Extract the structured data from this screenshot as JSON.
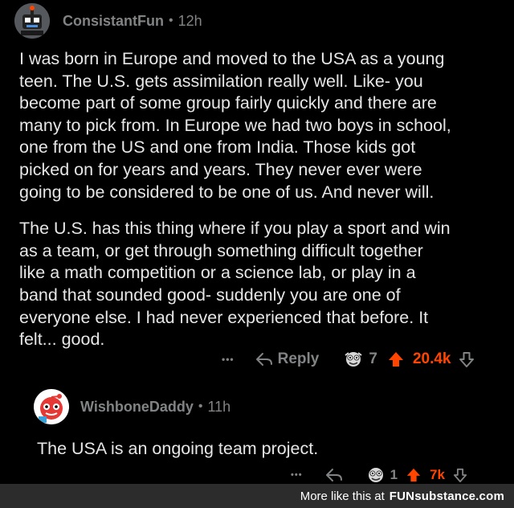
{
  "comment1": {
    "username": "ConsistantFun",
    "separator": "•",
    "time": "12h",
    "paragraph1_lines": [
      "I was born in Europe and moved to the USA as a young",
      "teen. The U.S. gets assimilation really well. Like- you",
      "become part of some group fairly quickly and there are",
      "many to pick from. In Europe we had two boys in school,",
      "one from the US and one from India. Those kids got",
      "picked on for years and years. They never ever were",
      "going to be considered to be one of us. And never will."
    ],
    "paragraph2_lines": [
      "The U.S. has this thing where if you play a sport and win",
      "as a team, or get through something difficult together",
      "like a math competition or a science lab, or play in a",
      "band that sounded good- suddenly you are one of",
      "everyone else. I had never experienced that before. It",
      "felt... good."
    ],
    "actions": {
      "more": "•••",
      "reply_icon": "reply-arrow-icon",
      "reply_label": "Reply",
      "award_icon": "award-face-icon",
      "award_count": "7",
      "upvote_icon": "upvote-arrow-icon",
      "upvote_count": "20.4k",
      "downvote_icon": "downvote-arrow-icon"
    }
  },
  "comment2": {
    "username": "WishboneDaddy",
    "separator": "•",
    "time": "11h",
    "text": "The USA is an ongoing team project.",
    "actions": {
      "more": "•••",
      "reply_icon": "reply-arrow-icon",
      "award_icon": "award-face-icon",
      "award_count": "1",
      "upvote_icon": "upvote-arrow-icon",
      "upvote_count": "7k",
      "downvote_icon": "downvote-arrow-icon"
    }
  },
  "footer": {
    "prefix": "More like this at",
    "brand_bold": "FUN",
    "brand_rest": "substance.com"
  },
  "colors": {
    "background": "#000000",
    "text": "#e6e6e6",
    "muted": "#818384",
    "upvote": "#ff4500",
    "footer_bg": "#2c2c2c"
  }
}
